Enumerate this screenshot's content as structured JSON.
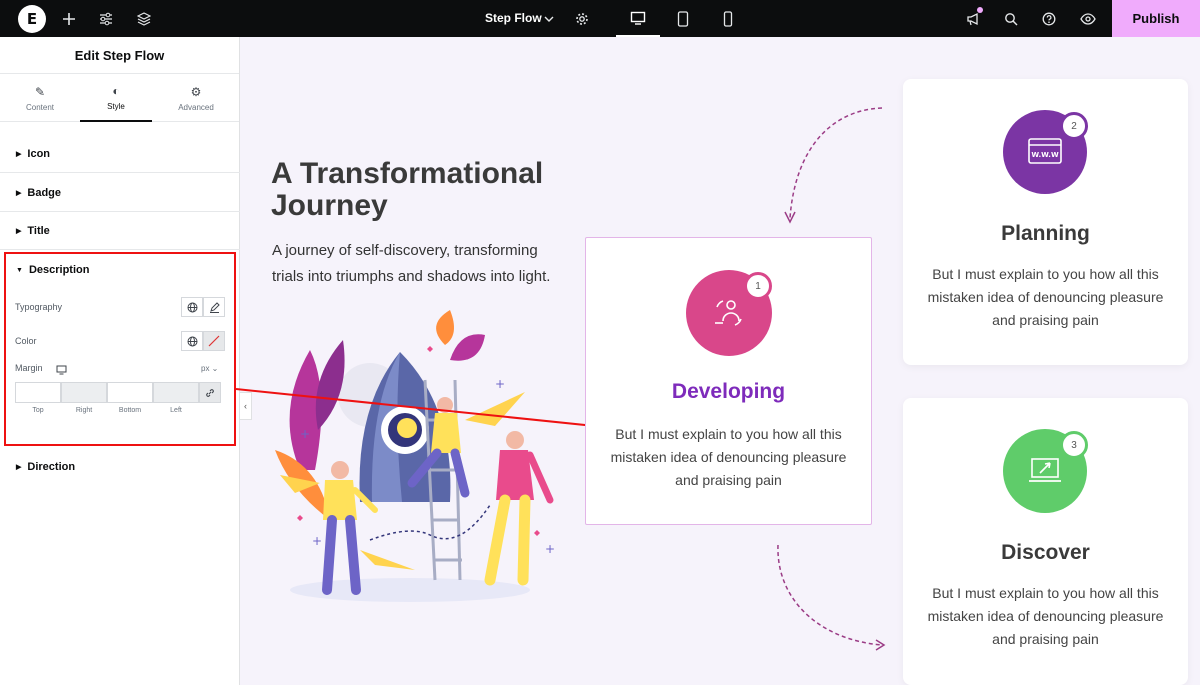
{
  "topbar": {
    "document_title": "Step Flow",
    "publish_label": "Publish"
  },
  "panel": {
    "header_title": "Edit Step Flow",
    "tabs": [
      {
        "label": "Content"
      },
      {
        "label": "Style"
      },
      {
        "label": "Advanced"
      }
    ],
    "sections": {
      "icon": "Icon",
      "badge": "Badge",
      "title": "Title",
      "description": "Description",
      "direction": "Direction"
    },
    "controls": {
      "typography_label": "Typography",
      "color_label": "Color",
      "margin_label": "Margin",
      "margin_unit": "px",
      "margin_sides": [
        "Top",
        "Right",
        "Bottom",
        "Left"
      ]
    }
  },
  "canvas": {
    "heading": "A Transformational Journey",
    "subtext": "A journey of self-discovery, transforming trials into triumphs and shadows into light.",
    "cards": [
      {
        "title": "Developing",
        "badge": "1",
        "description": "But I must explain to you how all this mistaken idea of denouncing pleasure and praising pain",
        "color": "#d9478a",
        "title_color": "#7e2bbb"
      },
      {
        "title": "Planning",
        "badge": "2",
        "description": "But I must explain to you how all this mistaken idea of denouncing pleasure and praising pain",
        "color": "#7b35a4",
        "title_color": "#3a3a3a"
      },
      {
        "title": "Discover",
        "badge": "3",
        "description": "But I must explain to you how all this mistaken idea of denouncing pleasure and praising pain",
        "color": "#5fcc6a",
        "title_color": "#3a3a3a"
      }
    ]
  },
  "icons": [
    "elementor-logo-icon",
    "add-icon",
    "settings-sliders-icon",
    "layers-icon",
    "gear-icon",
    "desktop-icon",
    "tablet-icon",
    "mobile-icon",
    "megaphone-icon",
    "search-icon",
    "help-icon",
    "eye-icon"
  ]
}
